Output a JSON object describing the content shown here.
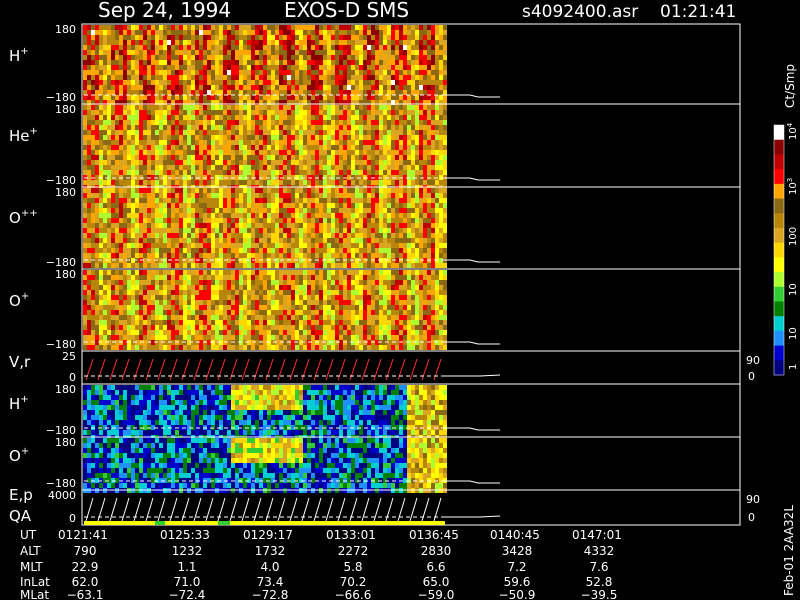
{
  "header": {
    "date": "Sep 24, 1994",
    "instrument": "EXOS-D SMS",
    "file": "s4092400.asr",
    "time": "01:21:41"
  },
  "side_label": "Feb-01 2AA32L",
  "colorbar": {
    "label": "Ct/Smp",
    "ticks": [
      "10",
      "10",
      "100",
      "10",
      "10",
      "1"
    ],
    "tick_exponents": [
      "4",
      "3",
      "",
      "",
      "",
      ""
    ],
    "colors": [
      "#ffffff",
      "#8b0000",
      "#c00000",
      "#ff0000",
      "#ffa500",
      "#8b6914",
      "#b8860b",
      "#daa520",
      "#ffd700",
      "#ffff00",
      "#adff2f",
      "#32cd32",
      "#008000",
      "#00ced1",
      "#1e90ff",
      "#0000cd",
      "#000080"
    ]
  },
  "panels": [
    {
      "label": "H",
      "sup": "+",
      "top": "180",
      "bottom": "−180",
      "kind": "spectrogram",
      "intensity": "high"
    },
    {
      "label": "He",
      "sup": "+",
      "top": "180",
      "bottom": "−180",
      "kind": "spectrogram",
      "intensity": "mid"
    },
    {
      "label": "O",
      "sup": "++",
      "top": "180",
      "bottom": "−180",
      "kind": "spectrogram",
      "intensity": "mid"
    },
    {
      "label": "O",
      "sup": "+",
      "top": "180",
      "bottom": "−180",
      "kind": "spectrogram",
      "intensity": "mid"
    },
    {
      "label": "V,r",
      "sup": "",
      "top": "25",
      "bottom": "0",
      "right_top": "90",
      "right_bottom": "0",
      "kind": "line"
    },
    {
      "label": "H",
      "sup": "+",
      "top": "180",
      "bottom": "−180",
      "kind": "spectrogram",
      "intensity": "low"
    },
    {
      "label": "O",
      "sup": "+",
      "top": "180",
      "bottom": "−180",
      "kind": "spectrogram",
      "intensity": "low"
    },
    {
      "label": "E,p",
      "label2": "QA",
      "sup": "",
      "top": "4000",
      "bottom": "0",
      "right_top": "90",
      "right_bottom": "0",
      "kind": "line"
    }
  ],
  "orbit_table": {
    "row_labels": [
      "UT",
      "ALT",
      "MLT",
      "InLat",
      "MLat"
    ],
    "columns": [
      {
        "UT": "0121:41",
        "ALT": "790",
        "MLT": "22.9",
        "InLat": "62.0",
        "MLat": "−63.1"
      },
      {
        "UT": "0125:33",
        "ALT": "1232",
        "MLT": "1.1",
        "InLat": "71.0",
        "MLat": "−72.4"
      },
      {
        "UT": "0129:17",
        "ALT": "1732",
        "MLT": "4.0",
        "InLat": "73.4",
        "MLat": "−72.8"
      },
      {
        "UT": "0133:01",
        "ALT": "2272",
        "MLT": "5.8",
        "InLat": "70.2",
        "MLat": "−66.6"
      },
      {
        "UT": "0136:45",
        "ALT": "2830",
        "MLT": "6.6",
        "InLat": "65.0",
        "MLat": "−59.0"
      },
      {
        "UT": "0140:45",
        "ALT": "3428",
        "MLT": "7.2",
        "InLat": "59.6",
        "MLat": "−50.9"
      },
      {
        "UT": "0147:01",
        "ALT": "4332",
        "MLT": "7.6",
        "InLat": "52.8",
        "MLat": "−39.5"
      }
    ]
  },
  "chart_data": {
    "type": "heatmap",
    "title": "Sep 24, 1994   EXOS-D SMS",
    "x_tick_labels": [
      "0121:41",
      "0125:33",
      "0129:17",
      "0133:01",
      "0136:45",
      "0140:45",
      "0147:01"
    ],
    "data_coverage_end": "0136:45",
    "series": [
      {
        "name": "H+",
        "y_range": [
          -180,
          180
        ]
      },
      {
        "name": "He+",
        "y_range": [
          -180,
          180
        ]
      },
      {
        "name": "O++",
        "y_range": [
          -180,
          180
        ]
      },
      {
        "name": "O+",
        "y_range": [
          -180,
          180
        ]
      },
      {
        "name": "V,r",
        "y_range": [
          0,
          25
        ]
      },
      {
        "name": "H+",
        "y_range": [
          -180,
          180
        ]
      },
      {
        "name": "O+",
        "y_range": [
          -180,
          180
        ]
      },
      {
        "name": "E,p",
        "y_range": [
          0,
          4000
        ]
      }
    ],
    "color_scale": {
      "label": "Ct/Smp",
      "type": "log",
      "range": [
        1,
        10000
      ]
    }
  }
}
